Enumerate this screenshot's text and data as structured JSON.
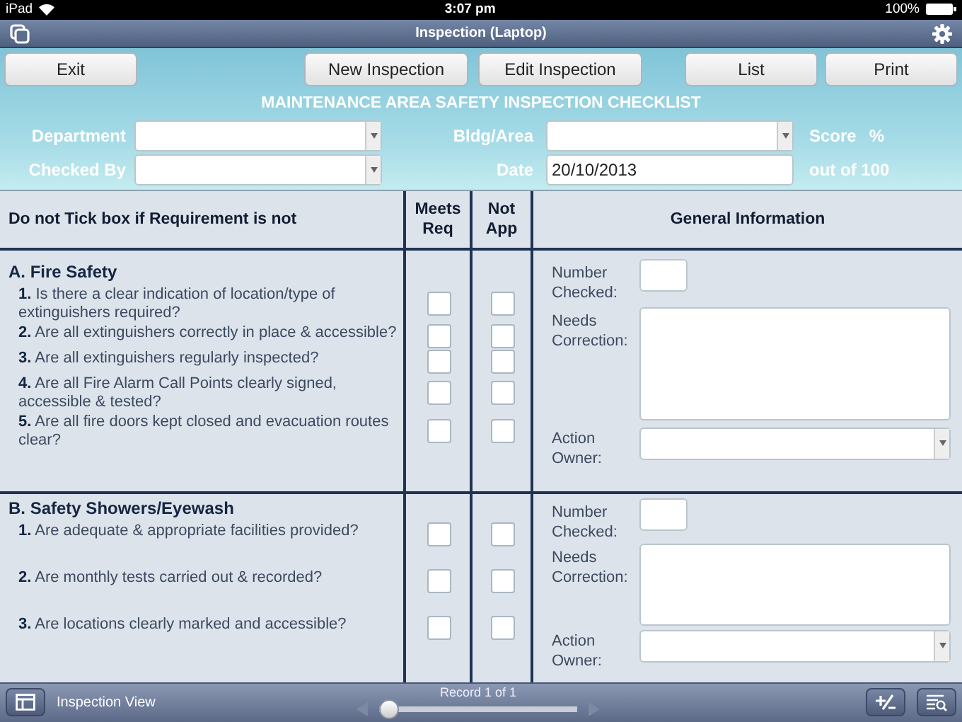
{
  "status_bar": {
    "device": "iPad",
    "time": "3:07 pm",
    "battery": "100%"
  },
  "window": {
    "title": "Inspection (Laptop)"
  },
  "toolbar": [
    {
      "label": "Exit",
      "kind": "left"
    },
    {
      "label": "New Inspection",
      "kind": "mid"
    },
    {
      "label": "Edit Inspection",
      "kind": "mid"
    },
    {
      "label": "List",
      "kind": "right"
    },
    {
      "label": "Print",
      "kind": "right"
    }
  ],
  "form": {
    "heading": "MAINTENANCE AREA SAFETY INSPECTION CHECKLIST",
    "fields": [
      {
        "label": "Department",
        "kind": "dropdown"
      },
      {
        "label": "Bldg/Area",
        "kind": "dropdown"
      },
      {
        "label": "Checked By",
        "kind": "dropdown"
      },
      {
        "label": "Date",
        "kind": "text",
        "value": "20/10/2013"
      }
    ],
    "score_label": "Score",
    "score_unit": "%",
    "out_of": "out of 100"
  },
  "table": {
    "columns": [
      "Do not Tick box if Requirement is not",
      "Meets Req",
      "Not App",
      "General Information"
    ],
    "sections": [
      {
        "title": "A. Fire Safety",
        "questions": [
          {
            "text": "**1.** Is there a clear indication of location/type of extinguishers required?",
            "meets": false,
            "not_app": false
          },
          {
            "text": "**2.** Are all extinguishers correctly in place & accessible?",
            "meets": false,
            "not_app": false
          },
          {
            "text": "**3.** Are all extinguishers  regularly inspected?",
            "meets": false,
            "not_app": false
          },
          {
            "text": "**4.** Are all Fire Alarm Call Points clearly signed, accessible & tested?",
            "meets": false,
            "not_app": false
          },
          {
            "text": "**5.** Are all fire doors kept closed and evacuation routes clear?",
            "meets": false,
            "not_app": false
          }
        ],
        "info": {
          "number_label": "Number Checked:",
          "correction_label": "Needs Correction:",
          "owner_label": "Action Owner:"
        }
      },
      {
        "title": "B. Safety Showers/Eyewash",
        "questions": [
          {
            "text": "**1.** Are adequate & appropriate facilities provided?",
            "meets": false,
            "not_app": false
          },
          {
            "text": "**2.** Are monthly tests carried out & recorded?",
            "meets": false,
            "not_app": false
          },
          {
            "text": "**3.** Are locations clearly marked and accessible?",
            "meets": false,
            "not_app": false
          }
        ],
        "info": {
          "number_label": "Number Checked:",
          "correction_label": "Needs Correction:",
          "owner_label": "Action Owner:"
        }
      }
    ]
  },
  "bottom_bar": {
    "view": "Inspection View",
    "record": "Record 1 of 1",
    "level": 0
  }
}
